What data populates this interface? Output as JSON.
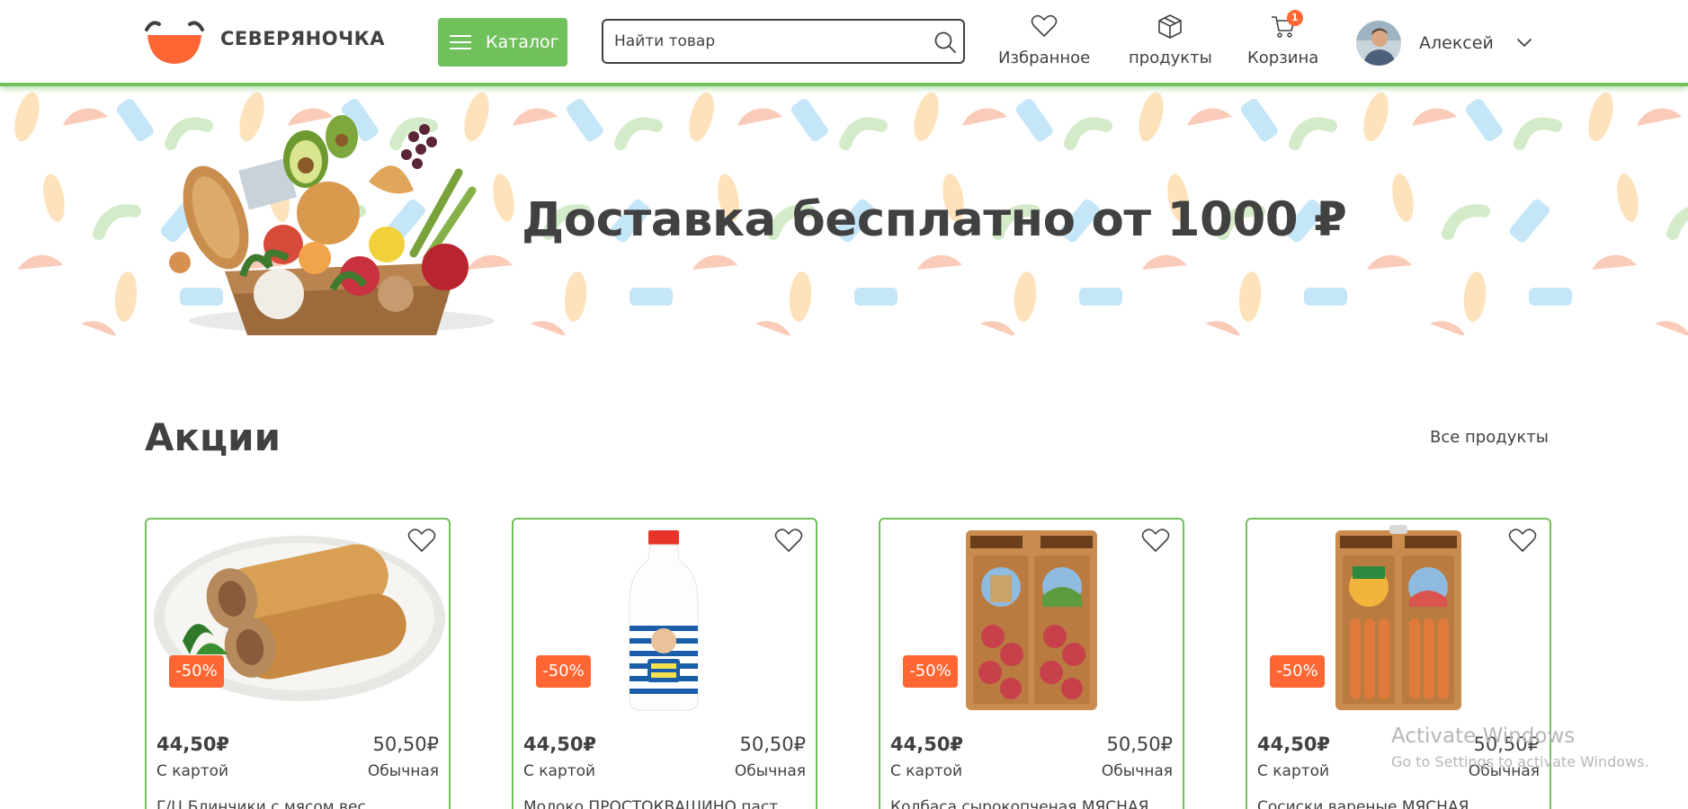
{
  "header": {
    "brand": "СЕВЕРЯНОЧКА",
    "catalog_label": "Каталог",
    "search_value": "Найти товар",
    "nav": [
      {
        "label": "Избранное",
        "icon": "heart-icon"
      },
      {
        "label": "продукты",
        "icon": "box-icon"
      },
      {
        "label": "Корзина",
        "icon": "cart-icon",
        "badge": "1"
      }
    ],
    "user_name": "Алексей"
  },
  "banner": {
    "title": "Доставка бесплатно от 1000 ₽"
  },
  "promo": {
    "title": "Акции",
    "all_link": "Все продукты",
    "cards": [
      {
        "image": "blini-pancakes",
        "discount": "-50%",
        "price_card": "44,50₽",
        "price_regular": "50,50₽",
        "label_card": "С картой",
        "label_regular": "Обычная",
        "name": "Г/Ц Блинчики с мясом вес..."
      },
      {
        "image": "milk-bottle",
        "discount": "-50%",
        "price_card": "44,50₽",
        "price_regular": "50,50₽",
        "label_card": "С картой",
        "label_regular": "Обычная",
        "name": "Молоко ПРОСТОКВАШИНО паст..."
      },
      {
        "image": "salami-pack",
        "discount": "-50%",
        "price_card": "44,50₽",
        "price_regular": "50,50₽",
        "label_card": "С картой",
        "label_regular": "Обычная",
        "name": "Колбаса сырокопченая МЯСНАЯ..."
      },
      {
        "image": "sausages-pack",
        "discount": "-50%",
        "price_card": "44,50₽",
        "price_regular": "50,50₽",
        "label_card": "С картой",
        "label_regular": "Обычная",
        "name": "Сосиски вареные МЯСНАЯ..."
      }
    ]
  },
  "watermark": {
    "title": "Activate Windows",
    "subtitle": "Go to Settings to activate Windows."
  },
  "colors": {
    "accent_green": "#70c05b",
    "accent_orange": "#ff6633",
    "text_dark": "#414141"
  }
}
